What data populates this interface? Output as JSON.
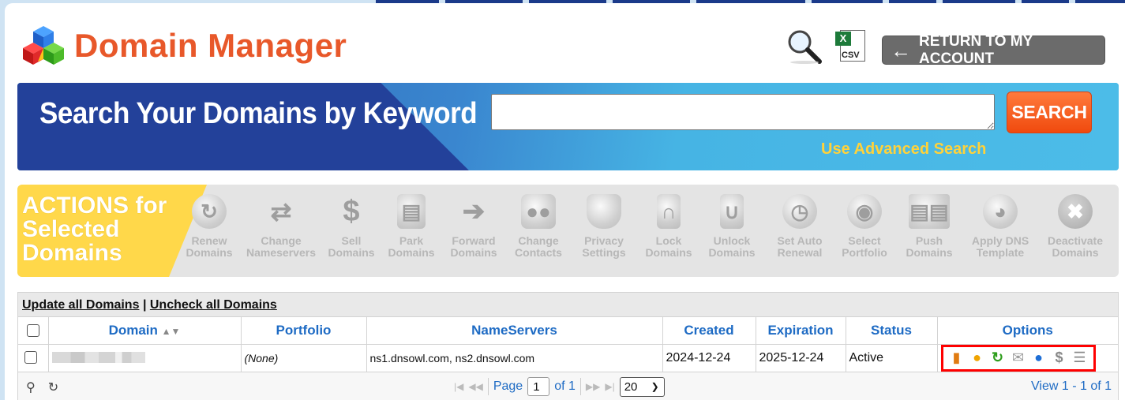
{
  "header": {
    "title": "Domain Manager",
    "return_label": "RETURN TO MY ACCOUNT",
    "csv_label": "CSV"
  },
  "search": {
    "title": "Search Your Domains by Keyword",
    "value": "",
    "button_label": "SEARCH",
    "advanced_label": "Use Advanced Search"
  },
  "actions": {
    "title_line1": "ACTIONS for",
    "title_line2": "Selected",
    "title_line3": "Domains",
    "items": [
      {
        "line1": "Renew",
        "line2": "Domains",
        "icon": "renew-icon"
      },
      {
        "line1": "Change",
        "line2": "Nameservers",
        "icon": "swap-arrows-icon"
      },
      {
        "line1": "Sell",
        "line2": "Domains",
        "icon": "dollar-icon"
      },
      {
        "line1": "Park",
        "line2": "Domains",
        "icon": "bus-icon"
      },
      {
        "line1": "Forward",
        "line2": "Domains",
        "icon": "forward-arrow-icon"
      },
      {
        "line1": "Change",
        "line2": "Contacts",
        "icon": "contacts-icon"
      },
      {
        "line1": "Privacy",
        "line2": "Settings",
        "icon": "privacy-tag-icon"
      },
      {
        "line1": "Lock",
        "line2": "Domains",
        "icon": "lock-icon"
      },
      {
        "line1": "Unlock",
        "line2": "Domains",
        "icon": "unlock-icon"
      },
      {
        "line1": "Set Auto",
        "line2": "Renewal",
        "icon": "clock-icon"
      },
      {
        "line1": "Select",
        "line2": "Portfolio",
        "icon": "portfolio-icon"
      },
      {
        "line1": "Push",
        "line2": "Domains",
        "icon": "push-servers-icon"
      },
      {
        "line1": "Apply DNS",
        "line2": "Template",
        "icon": "dns-template-icon"
      },
      {
        "line1": "Deactivate",
        "line2": "Domains",
        "icon": "deactivate-x-icon"
      }
    ]
  },
  "grid": {
    "update_all": "Update all Domains",
    "separator": "|",
    "uncheck_all": "Uncheck all Domains",
    "columns": [
      "Domain",
      "Portfolio",
      "NameServers",
      "Created",
      "Expiration",
      "Status",
      "Options"
    ],
    "rows": [
      {
        "domain": "",
        "portfolio": "(None)",
        "nameservers": "ns1.dnsowl.com, ns2.dnsowl.com",
        "created": "2024-12-24",
        "expiration": "2025-12-24",
        "status": "Active"
      }
    ],
    "pager": {
      "page_label": "Page",
      "page_value": "1",
      "of_label": "of 1",
      "per_page": "20",
      "view_text": "View 1 - 1 of 1"
    }
  },
  "colors": {
    "title_orange": "#e8582a",
    "link_blue": "#1e6bc4",
    "search_navy": "#23419a",
    "search_sky": "#4ab9e6",
    "search_button": "#f04a0e",
    "advanced_yellow": "#ffd23a",
    "actions_yellow": "#ffd84a",
    "highlight_red": "#ff0000"
  }
}
